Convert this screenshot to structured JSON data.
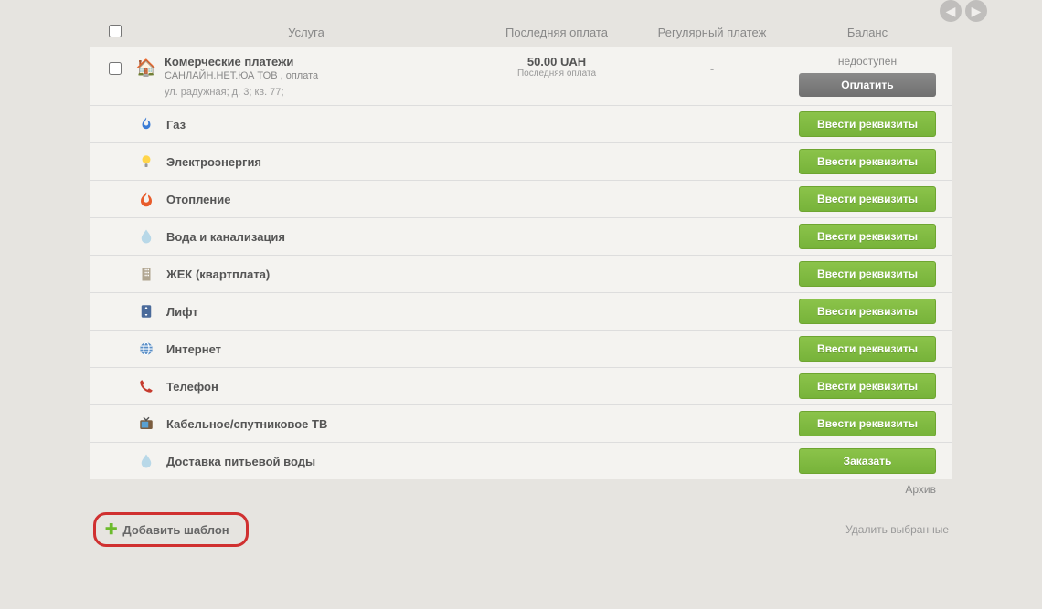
{
  "headers": {
    "service": "Услуга",
    "last_payment": "Последняя оплата",
    "regular_payment": "Регулярный платеж",
    "balance": "Баланс"
  },
  "main": {
    "title": "Комерческие платежи",
    "provider": "САНЛАЙН.НЕТ.ЮА ТОВ , оплата",
    "address": "ул. радужная; д. 3; кв. 77;",
    "last_amount": "50.00 UAH",
    "last_label": "Последняя оплата",
    "regular": "-",
    "balance_unavailable": "недоступен",
    "pay_button": "Оплатить"
  },
  "services": [
    {
      "id": "gas",
      "label": "Газ",
      "button": "Ввести реквизиты"
    },
    {
      "id": "electricity",
      "label": "Электроэнергия",
      "button": "Ввести реквизиты"
    },
    {
      "id": "heating",
      "label": "Отопление",
      "button": "Ввести реквизиты"
    },
    {
      "id": "water-sewage",
      "label": "Вода и канализация",
      "button": "Ввести реквизиты"
    },
    {
      "id": "zhek",
      "label": "ЖЕК (квартплата)",
      "button": "Ввести реквизиты"
    },
    {
      "id": "elevator",
      "label": "Лифт",
      "button": "Ввести реквизиты"
    },
    {
      "id": "internet",
      "label": "Интернет",
      "button": "Ввести реквизиты"
    },
    {
      "id": "phone",
      "label": "Телефон",
      "button": "Ввести реквизиты"
    },
    {
      "id": "cable-tv",
      "label": "Кабельное/спутниковое ТВ",
      "button": "Ввести реквизиты"
    },
    {
      "id": "water-delivery",
      "label": "Доставка питьевой воды",
      "button": "Заказать"
    }
  ],
  "footer": {
    "archive": "Архив",
    "add_template": "Добавить шаблон",
    "delete_selected": "Удалить выбранные"
  }
}
